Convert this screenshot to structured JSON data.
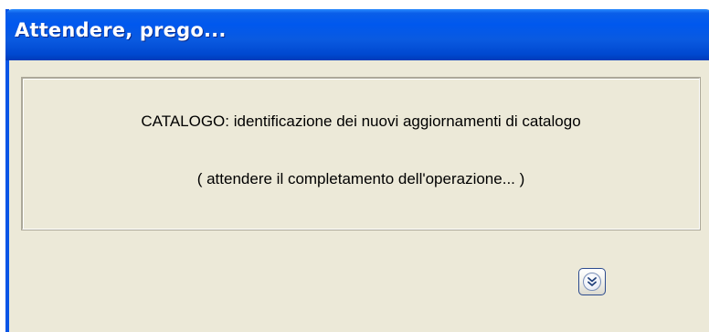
{
  "window": {
    "title": "Attendere, prego..."
  },
  "message": {
    "line1": "CATALOGO: identificazione dei nuovi aggiornamenti di catalogo",
    "line2": "( attendere il completamento dell'operazione... )"
  },
  "details_button": {
    "icon": "double-chevron-down-icon"
  },
  "colors": {
    "titlebar": "#0058ee",
    "window_background": "#ece9d8",
    "title_text": "#ffffff"
  }
}
